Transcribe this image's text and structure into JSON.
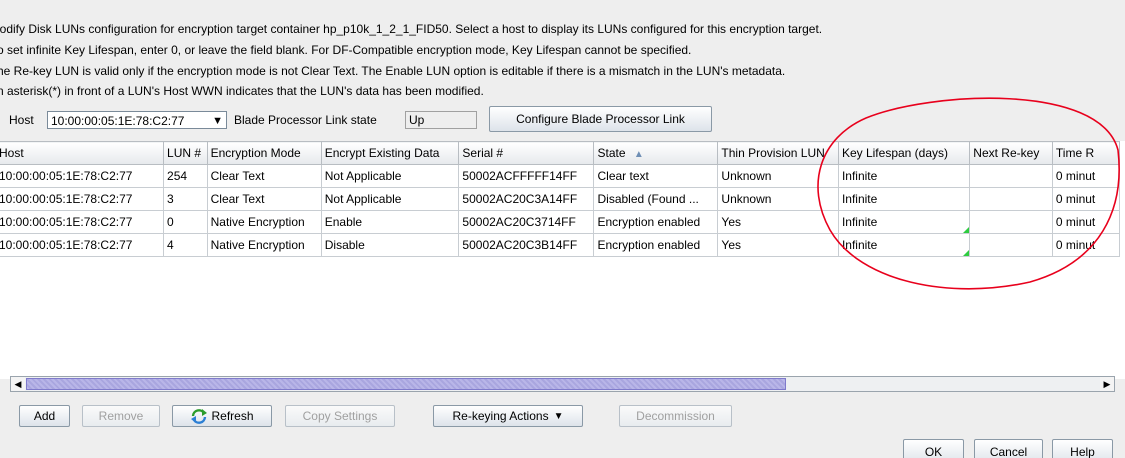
{
  "info": {
    "line1": "lodify Disk LUNs configuration for encryption target container hp_p10k_1_2_1_FID50. Select a host to display its LUNs configured for this encryption target.",
    "line2": "o set infinite Key Lifespan, enter 0, or leave the field blank. For DF-Compatible encryption mode, Key Lifespan cannot be specified.",
    "line3": "he Re-key LUN is valid only if the encryption mode is not Clear Text. The Enable LUN option is editable if there is a mismatch in the LUN's metadata.",
    "line4": "n asterisk(*) in front of a LUN's Host WWN indicates that the LUN's data has been modified."
  },
  "host_bar": {
    "host_label": "Host",
    "host_value": "10:00:00:05:1E:78:C2:77",
    "blade_label": "Blade Processor Link state",
    "blade_value": "Up",
    "configure_button": "Configure Blade Processor Link"
  },
  "table": {
    "columns": [
      "Host",
      "LUN #",
      "Encryption Mode",
      "Encrypt Existing Data",
      "Serial #",
      "State",
      "Thin Provision LUN",
      "Key Lifespan (days)",
      "Next Re-key",
      "Time R"
    ],
    "sort_indicator": "▲",
    "rows": [
      {
        "host": "10:00:00:05:1E:78:C2:77",
        "lun": "254",
        "mode": "Clear Text",
        "existing": "Not Applicable",
        "serial": "50002ACFFFFF14FF",
        "state": "Clear text",
        "thin": "Unknown",
        "lifespan": "Infinite",
        "rekey": "",
        "time": "0 minut"
      },
      {
        "host": "10:00:00:05:1E:78:C2:77",
        "lun": "3",
        "mode": "Clear Text",
        "existing": "Not Applicable",
        "serial": "50002AC20C3A14FF",
        "state": "Disabled (Found ...",
        "thin": "Unknown",
        "lifespan": "Infinite",
        "rekey": "",
        "time": "0 minut"
      },
      {
        "host": "10:00:00:05:1E:78:C2:77",
        "lun": "0",
        "mode": "Native Encryption",
        "existing": "Enable",
        "serial": "50002AC20C3714FF",
        "state": "Encryption enabled",
        "thin": "Yes",
        "lifespan": "Infinite",
        "rekey": "",
        "time": "0 minut"
      },
      {
        "host": "10:00:00:05:1E:78:C2:77",
        "lun": "4",
        "mode": "Native Encryption",
        "existing": "Disable",
        "serial": "50002AC20C3B14FF",
        "state": "Encryption enabled",
        "thin": "Yes",
        "lifespan": "Infinite",
        "rekey": "",
        "time": "0 minut"
      }
    ]
  },
  "actions": {
    "add": "Add",
    "remove": "Remove",
    "refresh": "Refresh",
    "copy_settings": "Copy Settings",
    "rekeying": "Re-keying Actions",
    "decommission": "Decommission"
  },
  "dialog": {
    "ok": "OK",
    "cancel": "Cancel",
    "help": "Help"
  },
  "colors": {
    "annotation": "#e8001c",
    "panel": "#eeeeee",
    "scroll_thumb": "#b0ade4"
  }
}
